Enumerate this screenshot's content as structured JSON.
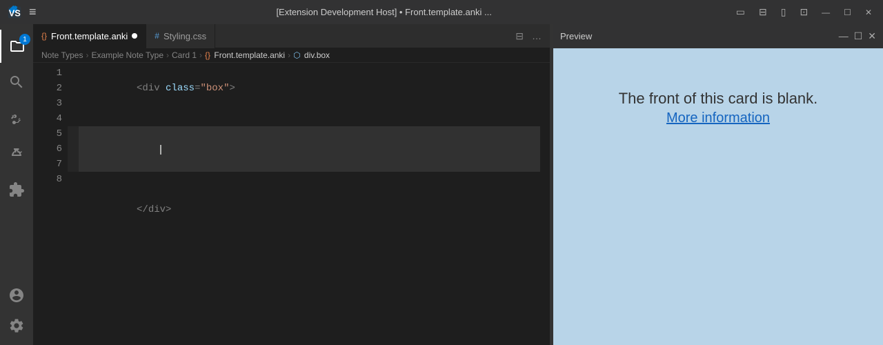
{
  "titleBar": {
    "title": "[Extension Development Host] • Front.template.anki ...",
    "windowControls": [
      "—",
      "☐",
      "✕"
    ]
  },
  "activityBar": {
    "items": [
      {
        "name": "explorer-icon",
        "icon": "files",
        "active": true,
        "badge": "1"
      },
      {
        "name": "search-icon",
        "icon": "search",
        "active": false
      },
      {
        "name": "source-control-icon",
        "icon": "git",
        "active": false
      },
      {
        "name": "run-debug-icon",
        "icon": "debug",
        "active": false
      },
      {
        "name": "extensions-icon",
        "icon": "extensions",
        "active": false
      }
    ],
    "bottomItems": [
      {
        "name": "accounts-icon",
        "icon": "account"
      },
      {
        "name": "settings-icon",
        "icon": "settings"
      }
    ]
  },
  "tabs": [
    {
      "label": "Front.template.anki",
      "icon": "{}",
      "modified": true,
      "active": true
    },
    {
      "label": "Styling.css",
      "icon": "#",
      "modified": false,
      "active": false
    }
  ],
  "tabActions": {
    "split": "⊟",
    "more": "…"
  },
  "breadcrumb": {
    "items": [
      {
        "label": "Note Types",
        "icon": "none"
      },
      {
        "label": "Example Note Type",
        "icon": "none"
      },
      {
        "label": "Card 1",
        "icon": "none"
      },
      {
        "label": "Front.template.anki",
        "icon": "curly"
      },
      {
        "label": "div.box",
        "icon": "box"
      }
    ]
  },
  "editor": {
    "lines": [
      {
        "number": 1,
        "content": "<div class=\"box\">",
        "tokens": [
          "<div ",
          "class",
          "=",
          "\"box\"",
          ">"
        ]
      },
      {
        "number": 2,
        "content": ""
      },
      {
        "number": 3,
        "content": "",
        "cursor": true
      },
      {
        "number": 4,
        "content": ""
      },
      {
        "number": 5,
        "content": "</div>",
        "tokens": [
          "</div>"
        ]
      },
      {
        "number": 6,
        "content": ""
      },
      {
        "number": 7,
        "content": ""
      },
      {
        "number": 8,
        "content": ""
      }
    ]
  },
  "preview": {
    "title": "Preview",
    "windowControls": [
      "—",
      "☐",
      "✕"
    ],
    "blankText": "The front of this card is blank.",
    "moreInfoText": "More information"
  }
}
